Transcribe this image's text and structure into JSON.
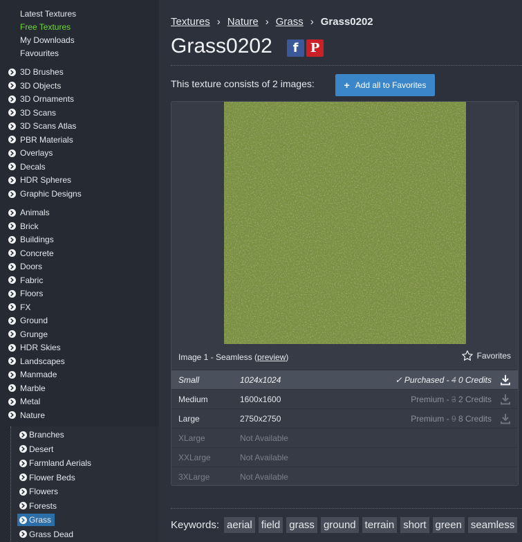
{
  "sidebar": {
    "top_links": [
      "Latest Textures",
      "Free Textures",
      "My Downloads",
      "Favourites"
    ],
    "group1": [
      "3D Brushes",
      "3D Objects",
      "3D Ornaments",
      "3D Scans",
      "3D Scans Atlas",
      "PBR Materials",
      "Overlays",
      "Decals",
      "HDR Spheres",
      "Graphic Designs"
    ],
    "group2": [
      "Animals",
      "Brick",
      "Buildings",
      "Concrete",
      "Doors",
      "Fabric",
      "Floors",
      "FX",
      "Ground",
      "Grunge",
      "HDR Skies",
      "Landscapes",
      "Manmade",
      "Marble",
      "Metal",
      "Nature"
    ],
    "nature_children": [
      "Branches",
      "Desert",
      "Farmland Aerials",
      "Flower Beds",
      "Flowers",
      "Forests",
      "Grass",
      "Grass Dead"
    ],
    "selected_child": "Grass",
    "active_top_link": "Free Textures"
  },
  "breadcrumb": {
    "items": [
      "Textures",
      "Nature",
      "Grass"
    ],
    "separator": "›",
    "current": "Grass0202"
  },
  "title": "Grass0202",
  "social": {
    "facebook": "f",
    "pinterest": "P"
  },
  "consists_text": "This texture consists of 2 images:",
  "add_all_favorites": {
    "icon": "+",
    "label": "Add all to Favorites"
  },
  "image": {
    "caption_prefix": "Image 1 - Seamless (",
    "preview_link": "preview",
    "caption_suffix": ")",
    "favorites_label": "Favorites",
    "sizes": [
      {
        "name": "Small",
        "resolution": "1024x1024",
        "status": "✓ Purchased - ",
        "old_credits": "4",
        "credits": "0 Credits",
        "type": "purchased"
      },
      {
        "name": "Medium",
        "resolution": "1600x1600",
        "status": "Premium - ",
        "old_credits": "3",
        "credits": "2 Credits",
        "type": "normal"
      },
      {
        "name": "Large",
        "resolution": "2750x2750",
        "status": "Premium - ",
        "old_credits": "9",
        "credits": "8 Credits",
        "type": "normal"
      },
      {
        "name": "XLarge",
        "resolution": "Not Available",
        "type": "na"
      },
      {
        "name": "XXLarge",
        "resolution": "Not Available",
        "type": "na"
      },
      {
        "name": "3XLarge",
        "resolution": "Not Available",
        "type": "na"
      }
    ]
  },
  "keywords": {
    "label": "Keywords:",
    "items": [
      "aerial",
      "field",
      "grass",
      "ground",
      "terrain",
      "short",
      "green",
      "seamless"
    ]
  },
  "colors": {
    "accent": "#3a86c8",
    "free_link": "#6fd63b",
    "selected": "#2b6ea8",
    "sidebar_bg": "#262a32",
    "page_bg": "#2c313b"
  }
}
